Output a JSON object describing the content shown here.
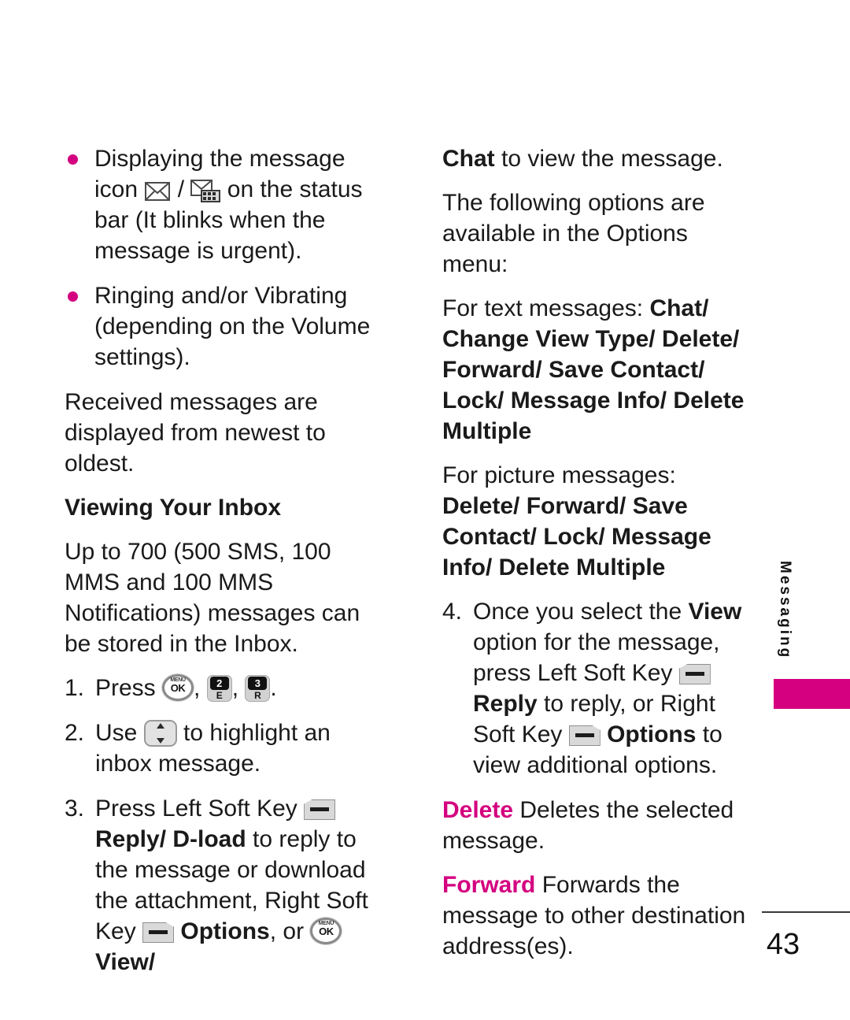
{
  "document": {
    "page_number": "43",
    "side_tab_label": "Messaging",
    "accent_color": "#d4007f"
  },
  "left_column": {
    "bullets": [
      {
        "part1": "Displaying the message icon",
        "icon_message": "message-envelope-icon",
        "separator": "/",
        "icon_mms": "multimedia-message-icon",
        "part2": "on the status bar (It blinks when the message is urgent)."
      },
      {
        "text": "Ringing and/or Vibrating (depending on the Volume settings)."
      }
    ],
    "paragraph_received": "Received messages are displayed from newest to oldest.",
    "heading_viewing_inbox": "Viewing Your Inbox",
    "paragraph_capacity": "Up to 700 (500 SMS, 100 MMS and 100 MMS Notifications) messages can be stored in the Inbox.",
    "steps": [
      {
        "number": "1.",
        "text_before": "Press",
        "key_ok_menu": "MENU",
        "key_ok_label": "OK",
        "key2_digit": "2",
        "key2_letter": "E",
        "key3_digit": "3",
        "key3_letter": "R",
        "comma": ",",
        "period": "."
      },
      {
        "number": "2.",
        "text_before": "Use",
        "text_after": "to highlight an inbox message."
      },
      {
        "number": "3.",
        "text_before": "Press Left Soft Key",
        "bold_reply_dload": "Reply/ D-load",
        "text_mid": "to reply to the message or download the attachment, Right Soft Key",
        "bold_options": "Options",
        "text_or": ", or",
        "bold_view": "View/"
      }
    ]
  },
  "right_column": {
    "line_chat": {
      "bold": "Chat",
      "rest": "to view the message."
    },
    "paragraph_options_intro": "The following options are available in the Options menu:",
    "text_messages": {
      "label": "For text messages:",
      "options": "Chat/ Change View Type/ Delete/ Forward/ Save Contact/ Lock/ Message Info/ Delete Multiple"
    },
    "picture_messages": {
      "label": "For picture messages:",
      "options": "Delete/ Forward/ Save Contact/ Lock/ Message Info/ Delete Multiple"
    },
    "step4": {
      "number": "4.",
      "part1": "Once you select the",
      "bold_view": "View",
      "part2": "option for the message, press Left Soft Key",
      "bold_reply": "Reply",
      "part3": "to reply, or Right Soft Key",
      "bold_options": "Options",
      "part4": "to view additional options."
    },
    "delete_entry": {
      "term": "Delete",
      "definition": "Deletes the selected message."
    },
    "forward_entry": {
      "term": "Forward",
      "definition": "Forwards the message to other destination address(es)."
    }
  }
}
